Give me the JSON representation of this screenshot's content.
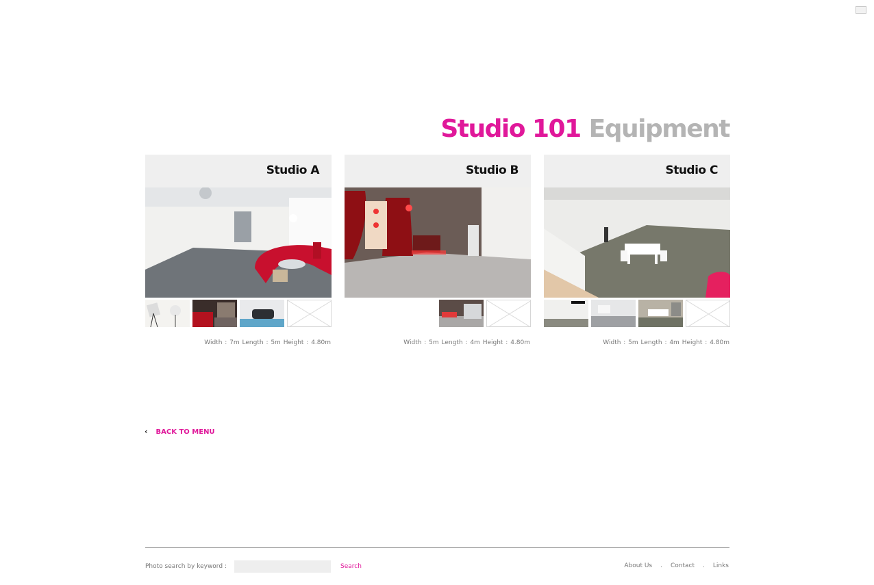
{
  "header": {
    "brand": "Studio 101",
    "section": "Equipment"
  },
  "studios": [
    {
      "name": "Studio A",
      "dims": "Width : 7m   Length : 5m   Height : 4.80m",
      "colors": {
        "floor": "#6f7479",
        "wall": "#f3f3f1",
        "accent": "#c8102e"
      }
    },
    {
      "name": "Studio B",
      "dims": "Width : 5m   Length : 4m   Height : 4.80m",
      "colors": {
        "floor": "#b9b6b4",
        "wall": "#6b5c56",
        "accent": "#8e0f14"
      }
    },
    {
      "name": "Studio C",
      "dims": "Width : 5m   Length : 4m   Height : 4.80m",
      "colors": {
        "floor": "#77786b",
        "wall": "#ececea",
        "accent": "#e5205f"
      }
    }
  ],
  "nav": {
    "back_label": "BACK TO MENU"
  },
  "footer": {
    "search_label": "Photo search by keyword :",
    "search_value": "",
    "search_button": "Search",
    "links": [
      "About Us",
      "Contact",
      "Links"
    ],
    "separator": "."
  },
  "colors": {
    "accent": "#e0189a",
    "muted": "#b4b4b4",
    "panel": "#efefef"
  }
}
